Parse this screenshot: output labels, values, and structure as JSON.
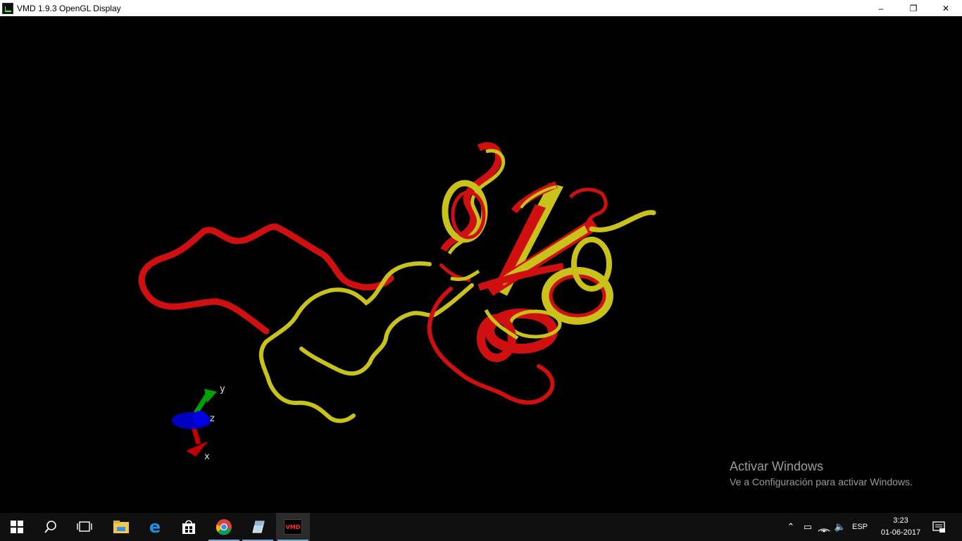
{
  "window": {
    "title": "VMD 1.9.3 OpenGL Display",
    "controls": {
      "minimize": "–",
      "maximize": "❐",
      "close": "✕"
    }
  },
  "axes": {
    "x": "x",
    "y": "y",
    "z": "z"
  },
  "molecules": [
    {
      "name": "red-ribbon",
      "color": "#d01010"
    },
    {
      "name": "yellow-ribbon",
      "color": "#c8c21a"
    }
  ],
  "watermark": {
    "title": "Activar Windows",
    "subtitle": "Ve a Configuración para activar Windows."
  },
  "taskbar": {
    "items": [
      "start-icon",
      "search-icon",
      "task-view-icon",
      "file-explorer-icon",
      "edge-icon",
      "store-icon",
      "chrome-icon",
      "app-icon",
      "vmd-icon"
    ],
    "vmd_label": "VMD",
    "language": "ESP",
    "time": "3:23",
    "date": "01-06-2017"
  }
}
